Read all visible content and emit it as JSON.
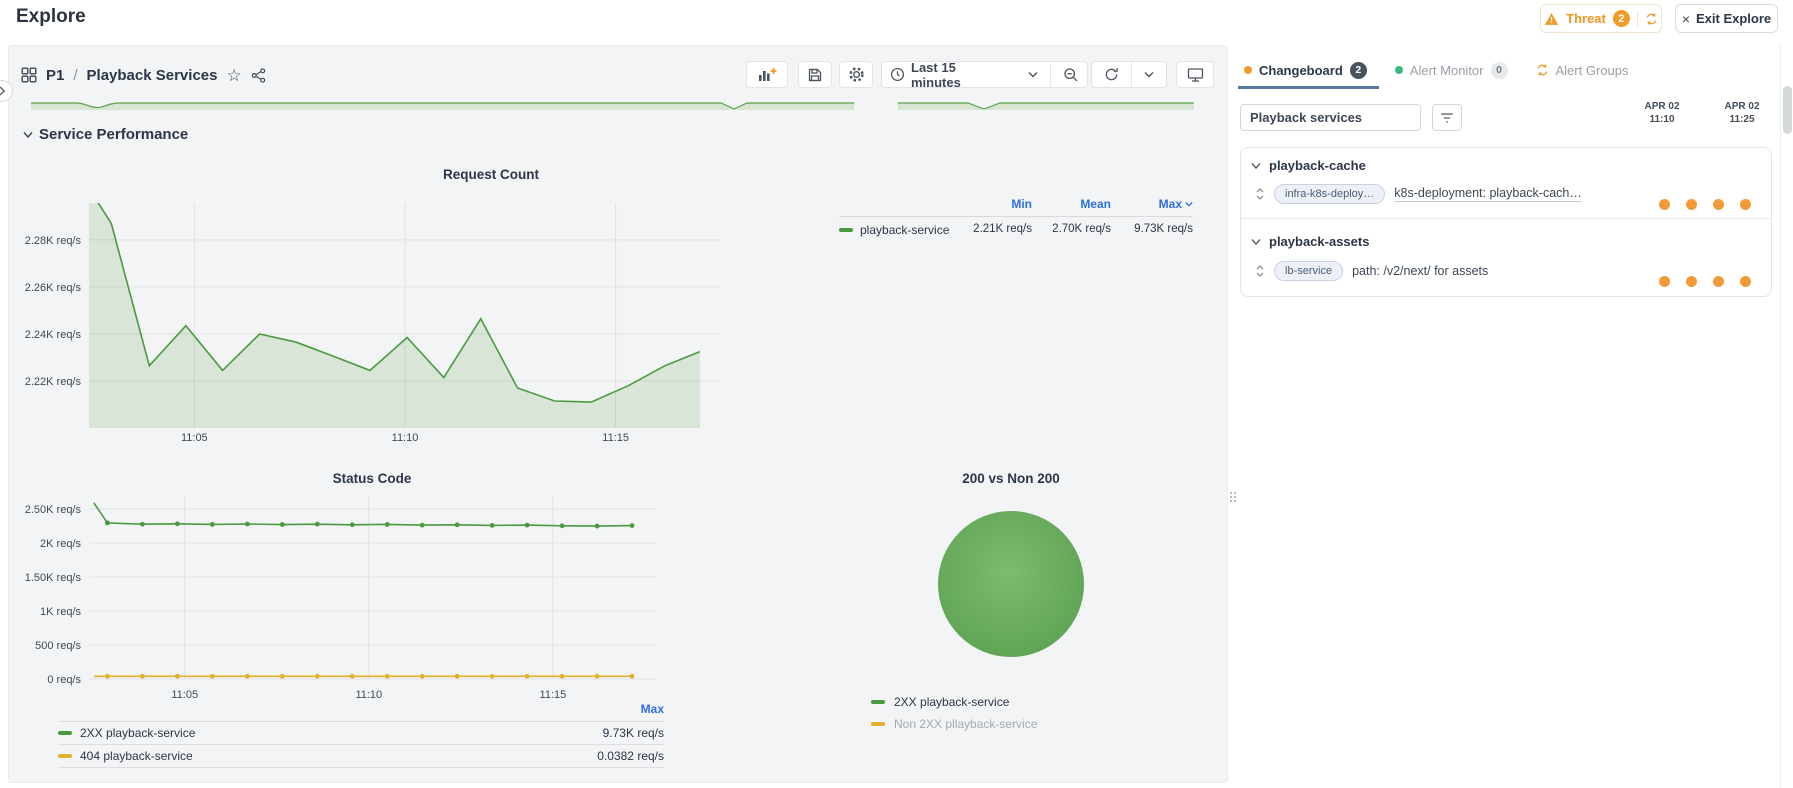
{
  "page": {
    "title": "Explore"
  },
  "header_actions": {
    "threat_label": "Threat",
    "threat_count": "2",
    "exit_label": "Exit Explore"
  },
  "board_header": {
    "code": "P1",
    "separator": "/",
    "name": "Playback Services"
  },
  "toolbar": {
    "time_range_label": "Last 15 minutes"
  },
  "main": {
    "section_title": "Service Performance"
  },
  "right_panel": {
    "tabs": [
      {
        "label": "Changeboard",
        "count": "2"
      },
      {
        "label": "Alert Monitor",
        "count": "0"
      },
      {
        "label": "Alert Groups"
      }
    ],
    "search_value": "Playback services",
    "time_columns": [
      {
        "date": "APR 02",
        "time": "11:10"
      },
      {
        "date": "APR 02",
        "time": "11:25"
      }
    ],
    "groups": [
      {
        "name": "playback-cache",
        "tag": "infra-k8s-deploy…",
        "description": "k8s-deployment: playback-cach…",
        "event_dots": 4
      },
      {
        "name": "playback-assets",
        "tag": "lb-service",
        "description": "path: /v2/next/ for assets",
        "event_dots": 4
      }
    ]
  },
  "colors": {
    "accent_orange": "#f09a28",
    "series_green": "#4a9a40",
    "series_yellow": "#e3b02d",
    "link_blue": "#2f6ee2",
    "tab_underline": "#54779e",
    "panel_bg": "#f3f4f5"
  },
  "chart_data": [
    {
      "id": "request_count",
      "type": "area",
      "title": "Request Count",
      "ylabel": "req/s",
      "series_name": "playback-service",
      "color": "#4a9a40",
      "fill": "rgba(74,154,64,0.16)",
      "x_minutes_after_11": [
        2.5,
        3.03,
        3.93,
        4.8,
        5.67,
        6.55,
        7.42,
        8.3,
        9.17,
        10.05,
        10.92,
        11.8,
        12.67,
        13.55,
        14.42,
        15.3,
        16.17,
        17.0
      ],
      "values_k_req_s": [
        2.302,
        2.287,
        2.2265,
        2.2435,
        2.2245,
        2.24,
        2.2365,
        2.2305,
        2.2245,
        2.2385,
        2.2215,
        2.2465,
        2.217,
        2.2115,
        2.211,
        2.218,
        2.2265,
        2.2325
      ],
      "xlim": [
        2.5,
        17.5
      ],
      "ylim": [
        2.2,
        2.2957
      ],
      "xticks": [
        {
          "v": 5,
          "label": "11:05"
        },
        {
          "v": 10,
          "label": "11:10"
        },
        {
          "v": 15,
          "label": "11:15"
        }
      ],
      "yticks": [
        {
          "v": 2.22,
          "label": "2.22K req/s"
        },
        {
          "v": 2.24,
          "label": "2.24K req/s"
        },
        {
          "v": 2.26,
          "label": "2.26K req/s"
        },
        {
          "v": 2.28,
          "label": "2.28K req/s"
        }
      ],
      "legend": {
        "headers": [
          "Min",
          "Mean",
          "Max"
        ],
        "row": {
          "name": "playback-service",
          "min": "2.21K req/s",
          "mean": "2.70K req/s",
          "max": "9.73K req/s"
        }
      }
    },
    {
      "id": "status_code",
      "type": "line",
      "title": "Status Code",
      "ylabel": "req/s",
      "x_minutes_after_11": [
        2.53,
        2.9,
        3.85,
        4.8,
        5.75,
        6.7,
        7.65,
        8.6,
        9.55,
        10.5,
        11.45,
        12.4,
        13.35,
        14.3,
        15.25,
        16.2,
        17.15
      ],
      "series": [
        {
          "name": "2XX playback-service",
          "color": "#4a9a40",
          "marker": true,
          "values_k_req_s": [
            2.59,
            2.295,
            2.275,
            2.282,
            2.272,
            2.278,
            2.27,
            2.276,
            2.267,
            2.272,
            2.262,
            2.267,
            2.258,
            2.262,
            2.252,
            2.248,
            2.255
          ]
        },
        {
          "name": "404 playback-service",
          "color": "#e3b02d",
          "marker": true,
          "values_k_req_s": [
            0.04,
            0.04,
            0.04,
            0.04,
            0.04,
            0.04,
            0.04,
            0.04,
            0.04,
            0.04,
            0.04,
            0.04,
            0.04,
            0.04,
            0.04,
            0.04,
            0.04
          ]
        }
      ],
      "xlim": [
        2.4,
        17.8
      ],
      "ylim": [
        0,
        2.69
      ],
      "xticks": [
        {
          "v": 5,
          "label": "11:05"
        },
        {
          "v": 10,
          "label": "11:10"
        },
        {
          "v": 15,
          "label": "11:15"
        }
      ],
      "yticks": [
        {
          "v": 0,
          "label": "0 req/s"
        },
        {
          "v": 0.5,
          "label": "500 req/s"
        },
        {
          "v": 1,
          "label": "1K req/s"
        },
        {
          "v": 1.5,
          "label": "1.50K req/s"
        },
        {
          "v": 2,
          "label": "2K req/s"
        },
        {
          "v": 2.5,
          "label": "2.50K req/s"
        }
      ],
      "legend": {
        "header": "Max",
        "rows": [
          {
            "name": "2XX playback-service",
            "value": "9.73K req/s"
          },
          {
            "name": "404 playback-service",
            "value": "0.0382 req/s"
          }
        ]
      }
    },
    {
      "id": "pie_200",
      "type": "pie",
      "title": "200 vs Non 200",
      "slices": [
        {
          "label": "2XX playback-service",
          "value_pct": 99.96,
          "color": "#68b05c",
          "dimmed": false
        },
        {
          "label": "Non 2XX pllayback-service",
          "value_pct": 0.04,
          "color": "#e3b02d",
          "dimmed": true
        }
      ]
    }
  ]
}
